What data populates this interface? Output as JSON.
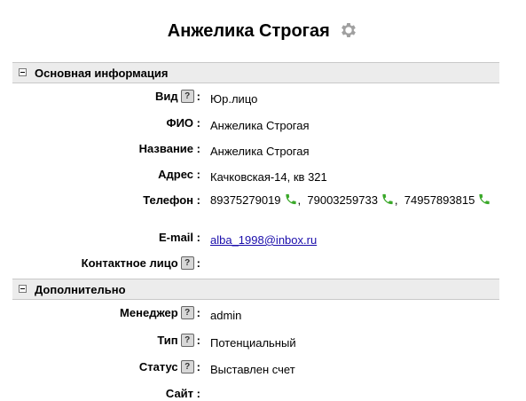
{
  "header": {
    "title": "Анжелика Строгая"
  },
  "sections": {
    "main": {
      "title": "Основная информация"
    },
    "extra": {
      "title": "Дополнительно"
    }
  },
  "fields": {
    "type": {
      "label": "Вид",
      "sep": ":",
      "value": "Юр.лицо"
    },
    "fio": {
      "label": "ФИО",
      "sep": ":",
      "value": "Анжелика Строгая"
    },
    "name": {
      "label": "Название",
      "sep": ":",
      "value": "Анжелика Строгая"
    },
    "address": {
      "label": "Адрес",
      "sep": ":",
      "value": "Качковская-14, кв 321"
    },
    "phone": {
      "label": "Телефон",
      "sep": ":",
      "numbers": [
        "89375279019",
        "79003259733",
        "74957893815"
      ],
      "separator": ","
    },
    "email": {
      "label": "E-mail",
      "sep": ":",
      "value": "alba_1998@inbox.ru"
    },
    "contact": {
      "label": "Контактное лицо",
      "sep": ":"
    },
    "manager": {
      "label": "Менеджер",
      "sep": ":",
      "value": "admin"
    },
    "kind": {
      "label": "Тип",
      "sep": ":",
      "value": "Потенциальный"
    },
    "status": {
      "label": "Статус",
      "sep": ":",
      "value": "Выставлен счет"
    },
    "site": {
      "label": "Сайт",
      "sep": ":"
    }
  },
  "help_glyph": "?",
  "icons": {
    "settings": "gear-icon",
    "phone": "phone-icon",
    "help": "help-icon",
    "collapse": "collapse-icon"
  },
  "colors": {
    "phone_icon": "#3aa829",
    "gear": "#a0a0a0",
    "link": "#1a0dab"
  }
}
